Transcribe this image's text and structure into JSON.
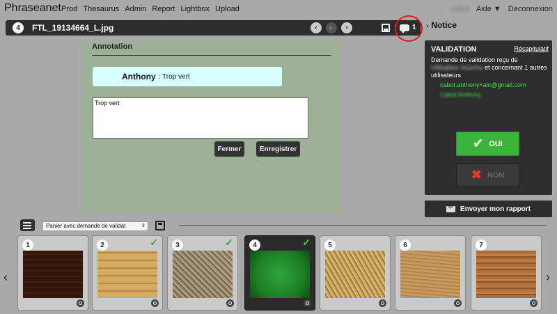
{
  "app": {
    "logo": "Phraseanet"
  },
  "nav": {
    "items": [
      "Prod",
      "Thesaurus",
      "Admin",
      "Report",
      "Lightbox",
      "Upload"
    ]
  },
  "user": {
    "name": "cabot",
    "help": "Aide ▼",
    "logout": "Deconnexion"
  },
  "titlebar": {
    "index": "4",
    "filename": "FTL_19134664_L.jpg",
    "prev": "‹",
    "play": "▶",
    "next": "›",
    "comment_count": "1"
  },
  "annotation": {
    "title": "Annotation",
    "comment_author": "Anthony",
    "comment_text": ": Trop vert",
    "textarea_value": "Trop vert",
    "cancel_label": "Fermer",
    "save_label": "Enregistrer"
  },
  "notice": {
    "chevron": "›",
    "label": "Notice"
  },
  "validation": {
    "title": "VALIDATION",
    "recap_link": "Récapitulatif",
    "text_before": "Demande de validation reçu de",
    "text_blurred": "Utilisateur Inconnu",
    "text_after": "et concernant 1 autres utilisateurs",
    "user_email": "cabot.anthony+alc@gmail.com",
    "user_name": "Cabot Anthony",
    "yes_label": "OUI",
    "no_label": "NON",
    "report_label": "Envoyer mon rapport"
  },
  "basket": {
    "selected": "Panier avec demande de validat",
    "arrows": {
      "left": "‹",
      "right": "›"
    },
    "thumbnails": [
      {
        "index": "1",
        "approved": false,
        "texture": "bricks"
      },
      {
        "index": "2",
        "approved": true,
        "texture": "wood-planks"
      },
      {
        "index": "3",
        "approved": true,
        "texture": "straw"
      },
      {
        "index": "4",
        "approved": true,
        "texture": "green",
        "active": true
      },
      {
        "index": "5",
        "approved": false,
        "texture": "wood-chips"
      },
      {
        "index": "6",
        "approved": false,
        "texture": "plywood"
      },
      {
        "index": "7",
        "approved": false,
        "texture": "wood-grain"
      }
    ]
  },
  "colors": {
    "accent_green": "#3cb43b",
    "highlight_red": "#e01818",
    "dark_panel": "#2e2e2e"
  }
}
